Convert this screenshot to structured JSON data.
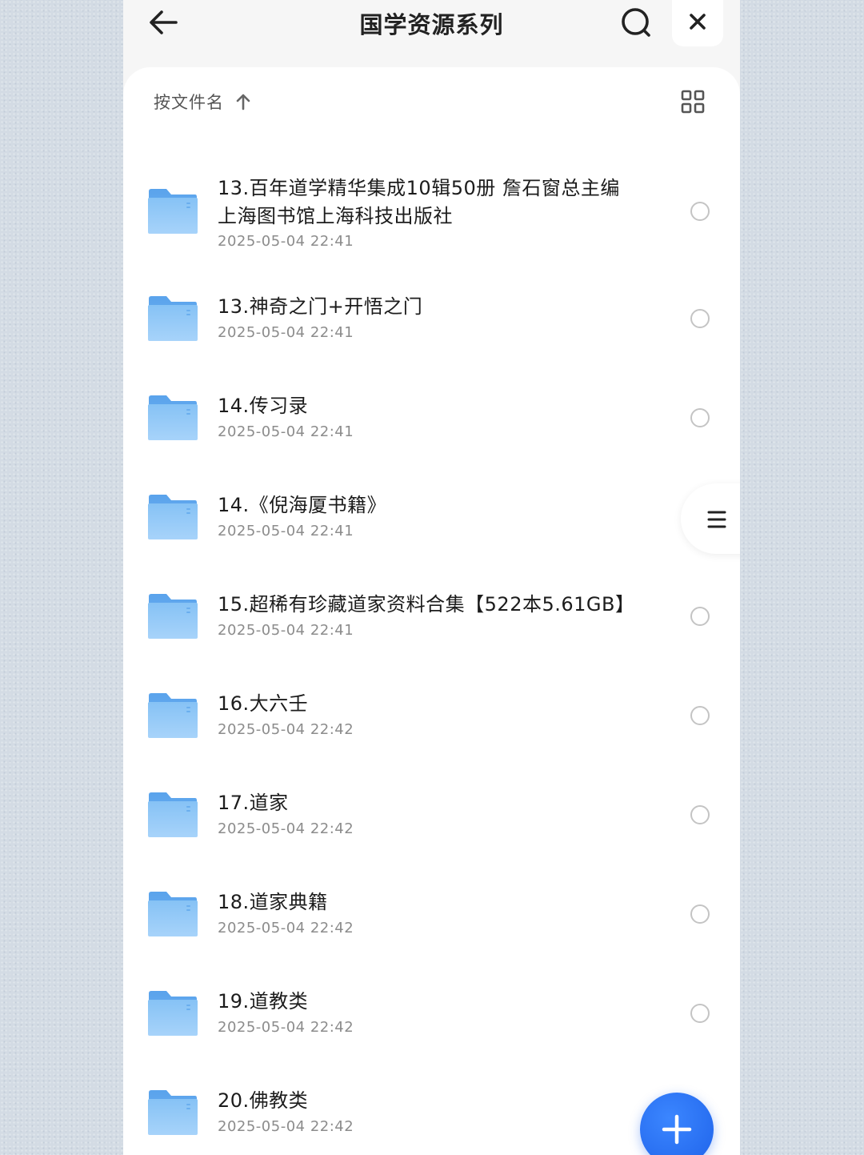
{
  "header": {
    "title": "国学资源系列",
    "back_icon": "arrow-left-icon",
    "search_icon": "search-icon",
    "close_icon": "close-icon"
  },
  "toolbar": {
    "sort_label": "按文件名",
    "sort_icon": "arrow-up-icon",
    "view_icon": "grid-view-icon"
  },
  "files": [
    {
      "name_line1": "13.百年道学精华集成10辑50册 詹石窗总主编",
      "name_line2": " 上海图书馆上海科技出版社",
      "date": "2025-05-04 22:41"
    },
    {
      "name": "13.神奇之门+开悟之门",
      "date": "2025-05-04 22:41"
    },
    {
      "name": "14.传习录",
      "date": "2025-05-04 22:41"
    },
    {
      "name": "14.《倪海厦书籍》",
      "date": "2025-05-04 22:41"
    },
    {
      "name": "15.超稀有珍藏道家资料合集【522本5.61GB】",
      "date": "2025-05-04 22:41"
    },
    {
      "name": "16.大六壬",
      "date": "2025-05-04 22:42"
    },
    {
      "name": "17.道家",
      "date": "2025-05-04 22:42"
    },
    {
      "name": "18.道家典籍",
      "date": "2025-05-04 22:42"
    },
    {
      "name": "19.道教类",
      "date": "2025-05-04 22:42"
    },
    {
      "name": "20.佛教类",
      "date": "2025-05-04 22:42"
    }
  ],
  "side_menu_icon": "menu-icon",
  "fab_icon": "plus-icon",
  "colors": {
    "accent": "#1f63ea",
    "folder": "#7fbaf3",
    "background": "#d3dbe4"
  }
}
